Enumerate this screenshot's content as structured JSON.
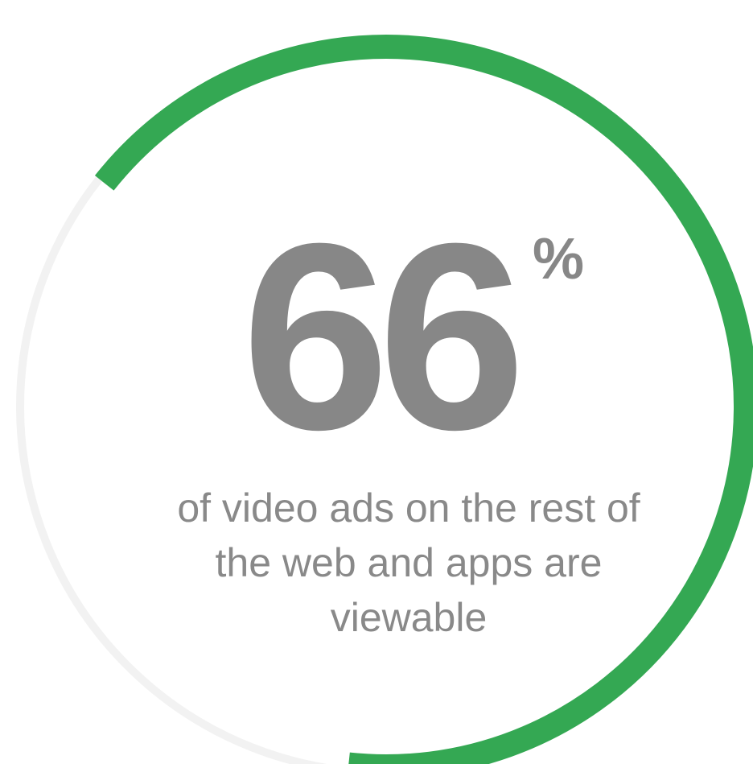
{
  "chart_data": {
    "type": "pie",
    "variant": "progress-ring",
    "value": 66,
    "max": 100,
    "colors": {
      "progress": "#34a853",
      "track": "#f2f2f2",
      "text": "#878787"
    }
  },
  "stat": {
    "number": "66",
    "unit": "%"
  },
  "caption": {
    "lines": [
      "of video ads on the rest of",
      "the web and apps are",
      "viewable"
    ]
  }
}
